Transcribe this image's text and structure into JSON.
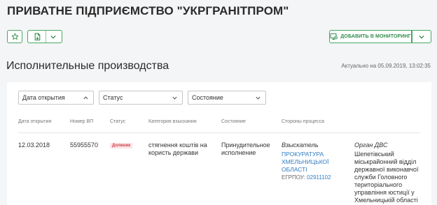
{
  "company": {
    "title": "ПРИВАТНЕ ПІДПРИЄМСТВО \"УКРГРАНІТПРОМ\""
  },
  "toolbar": {
    "favorite_icon": "star-icon",
    "document_icon": "document-icon",
    "monitor_label": "ДОБАВИТЬ В МОНИТОРИНГ"
  },
  "section": {
    "title": "Исполнительные производства",
    "updated": "Актуально на 05.09.2019, 13:02:35"
  },
  "filters": {
    "date": "Дата открытия",
    "status": "Статус",
    "state": "Состояние"
  },
  "table": {
    "headers": [
      "Дата открытия",
      "Номер ВП",
      "Статус",
      "Категория взыскания",
      "Состояние",
      "Стороны процесса"
    ],
    "rows": [
      {
        "date": "12.03.2018",
        "number": "55955570",
        "status": "Должник",
        "category": "стягнення коштів на користь держави",
        "state": "Принудительное исполнение",
        "party_role": "Взыскатель",
        "party_name": "ПРОКУРАТУРА ХМЕЛЬНИЦЬКОЇ ОБЛАСТІ",
        "edrpou_label": "ЕГРПОУ:",
        "edrpou_code": "02911102",
        "organ_role": "Орган ДВС",
        "organ_name": "Шепетівський міськрайонний відділ державної виконавчої служби Головного територіального управління юстиції у Хмельницькій області"
      }
    ]
  },
  "colors": {
    "accent_green": "#47a663",
    "link_blue": "#2d7cc1",
    "debtor_badge": "#d2434f"
  }
}
